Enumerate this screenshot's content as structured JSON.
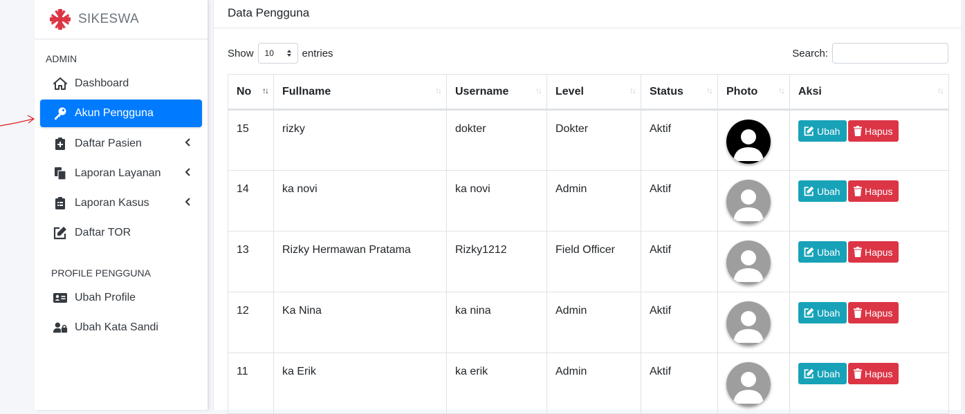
{
  "brand": {
    "name": "SIKESWA",
    "logo_icon": "red-cross-logo-icon"
  },
  "sidebar": {
    "admin_header": "ADMIN",
    "items": [
      {
        "label": "Dashboard",
        "icon": "home-icon"
      },
      {
        "label": "Akun Pengguna",
        "icon": "key-icon",
        "active": true
      },
      {
        "label": "Daftar Pasien",
        "icon": "medical-file-icon",
        "has_submenu": true
      },
      {
        "label": "Laporan Layanan",
        "icon": "copy-icon",
        "has_submenu": true
      },
      {
        "label": "Laporan Kasus",
        "icon": "clipboard-list-icon",
        "has_submenu": true
      },
      {
        "label": "Daftar TOR",
        "icon": "edit-icon"
      }
    ],
    "profile_header": "PROFILE PENGGUNA",
    "profile_items": [
      {
        "label": "Ubah Profile",
        "icon": "id-card-icon"
      },
      {
        "label": "Ubah Kata Sandi",
        "icon": "user-lock-icon"
      }
    ],
    "active_color": "#007bff"
  },
  "main": {
    "title": "Data Pengguna",
    "show_label": "Show",
    "entries_label": "entries",
    "page_length": "10",
    "search_label": "Search:",
    "search_value": "",
    "table": {
      "columns": [
        "No",
        "Fullname",
        "Username",
        "Level",
        "Status",
        "Photo",
        "Aksi"
      ],
      "rows": [
        {
          "no": "15",
          "fullname": "rizky",
          "username": "dokter",
          "level": "Dokter",
          "status": "Aktif",
          "photo": "dark"
        },
        {
          "no": "14",
          "fullname": "ka novi",
          "username": "ka novi",
          "level": "Admin",
          "status": "Aktif",
          "photo": "gray"
        },
        {
          "no": "13",
          "fullname": "Rizky Hermawan Pratama",
          "username": "Rizky1212",
          "level": "Field Officer",
          "status": "Aktif",
          "photo": "gray"
        },
        {
          "no": "12",
          "fullname": "Ka Nina",
          "username": "ka nina",
          "level": "Admin",
          "status": "Aktif",
          "photo": "gray"
        },
        {
          "no": "11",
          "fullname": "ka Erik",
          "username": "ka erik",
          "level": "Admin",
          "status": "Aktif",
          "photo": "gray"
        }
      ],
      "edit_label": "Ubah",
      "delete_label": "Hapus"
    },
    "colors": {
      "edit": "#17a2b8",
      "delete": "#dc3545"
    }
  }
}
